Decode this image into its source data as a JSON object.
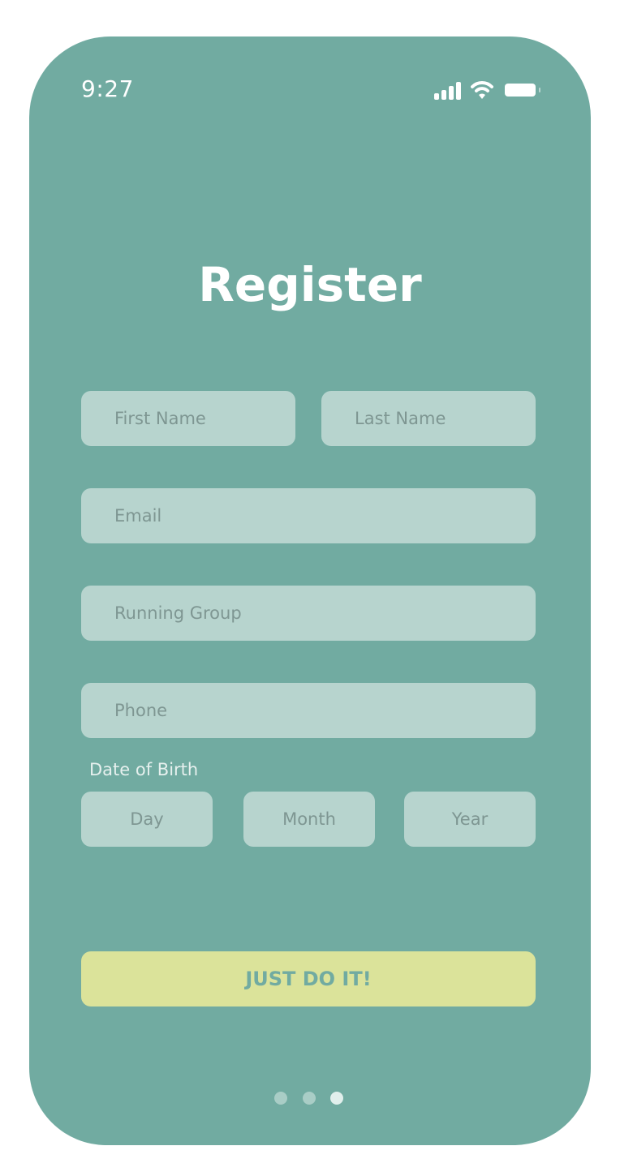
{
  "status_bar": {
    "time": "9:27",
    "icons": [
      "cellular-signal-icon",
      "wifi-icon",
      "battery-icon"
    ]
  },
  "screen": {
    "title": "Register",
    "fields": {
      "first_name": {
        "placeholder": "First Name",
        "value": ""
      },
      "last_name": {
        "placeholder": "Last Name",
        "value": ""
      },
      "email": {
        "placeholder": "Email",
        "value": ""
      },
      "running_group": {
        "placeholder": "Running Group",
        "value": ""
      },
      "phone": {
        "placeholder": "Phone",
        "value": ""
      }
    },
    "date_of_birth": {
      "label": "Date of Birth",
      "day": {
        "placeholder": "Day",
        "value": ""
      },
      "month": {
        "placeholder": "Month",
        "value": ""
      },
      "year": {
        "placeholder": "Year",
        "value": ""
      }
    },
    "submit_label": "JUST DO IT!"
  },
  "pagination": {
    "total_pages": 3,
    "current_page": 3
  },
  "colors": {
    "background": "#71aba1",
    "field": "#b7d4ce",
    "placeholder_text": "#7e9692",
    "button": "#dbe39a",
    "button_text": "#71aba1",
    "dot_inactive": "#a9cdc6",
    "dot_active": "#e1efec"
  }
}
